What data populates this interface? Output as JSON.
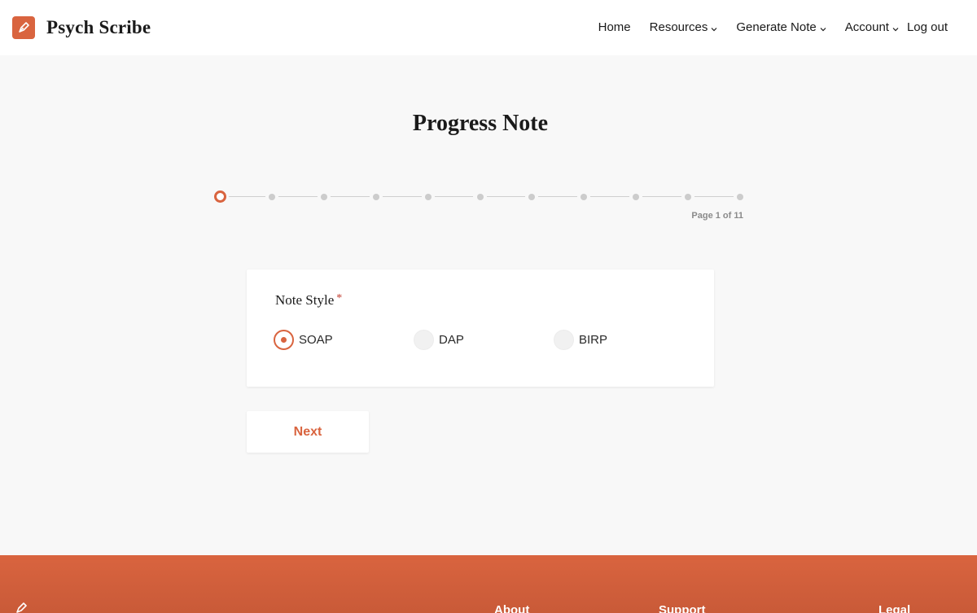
{
  "app": {
    "name": "Psych Scribe",
    "logo_icon": "pen-nib-icon"
  },
  "nav": {
    "items": [
      {
        "label": "Home",
        "dropdown": false
      },
      {
        "label": "Resources",
        "dropdown": true
      },
      {
        "label": "Generate Note",
        "dropdown": true
      },
      {
        "label": "Account",
        "dropdown": true
      },
      {
        "label": "Log out",
        "dropdown": false
      }
    ]
  },
  "page": {
    "title": "Progress Note"
  },
  "stepper": {
    "current": 1,
    "total": 11,
    "indicator": "Page 1 of 11"
  },
  "form": {
    "field_label": "Note Style",
    "required_marker": "*",
    "options": [
      {
        "label": "SOAP",
        "checked": true
      },
      {
        "label": "DAP",
        "checked": false
      },
      {
        "label": "BIRP",
        "checked": false
      }
    ]
  },
  "actions": {
    "next_label": "Next"
  },
  "footer": {
    "columns": [
      "About",
      "Support",
      "Legal"
    ]
  },
  "colors": {
    "accent": "#d9643f",
    "page_bg": "#f8f8f8",
    "footer_bg": "#d9643f"
  }
}
